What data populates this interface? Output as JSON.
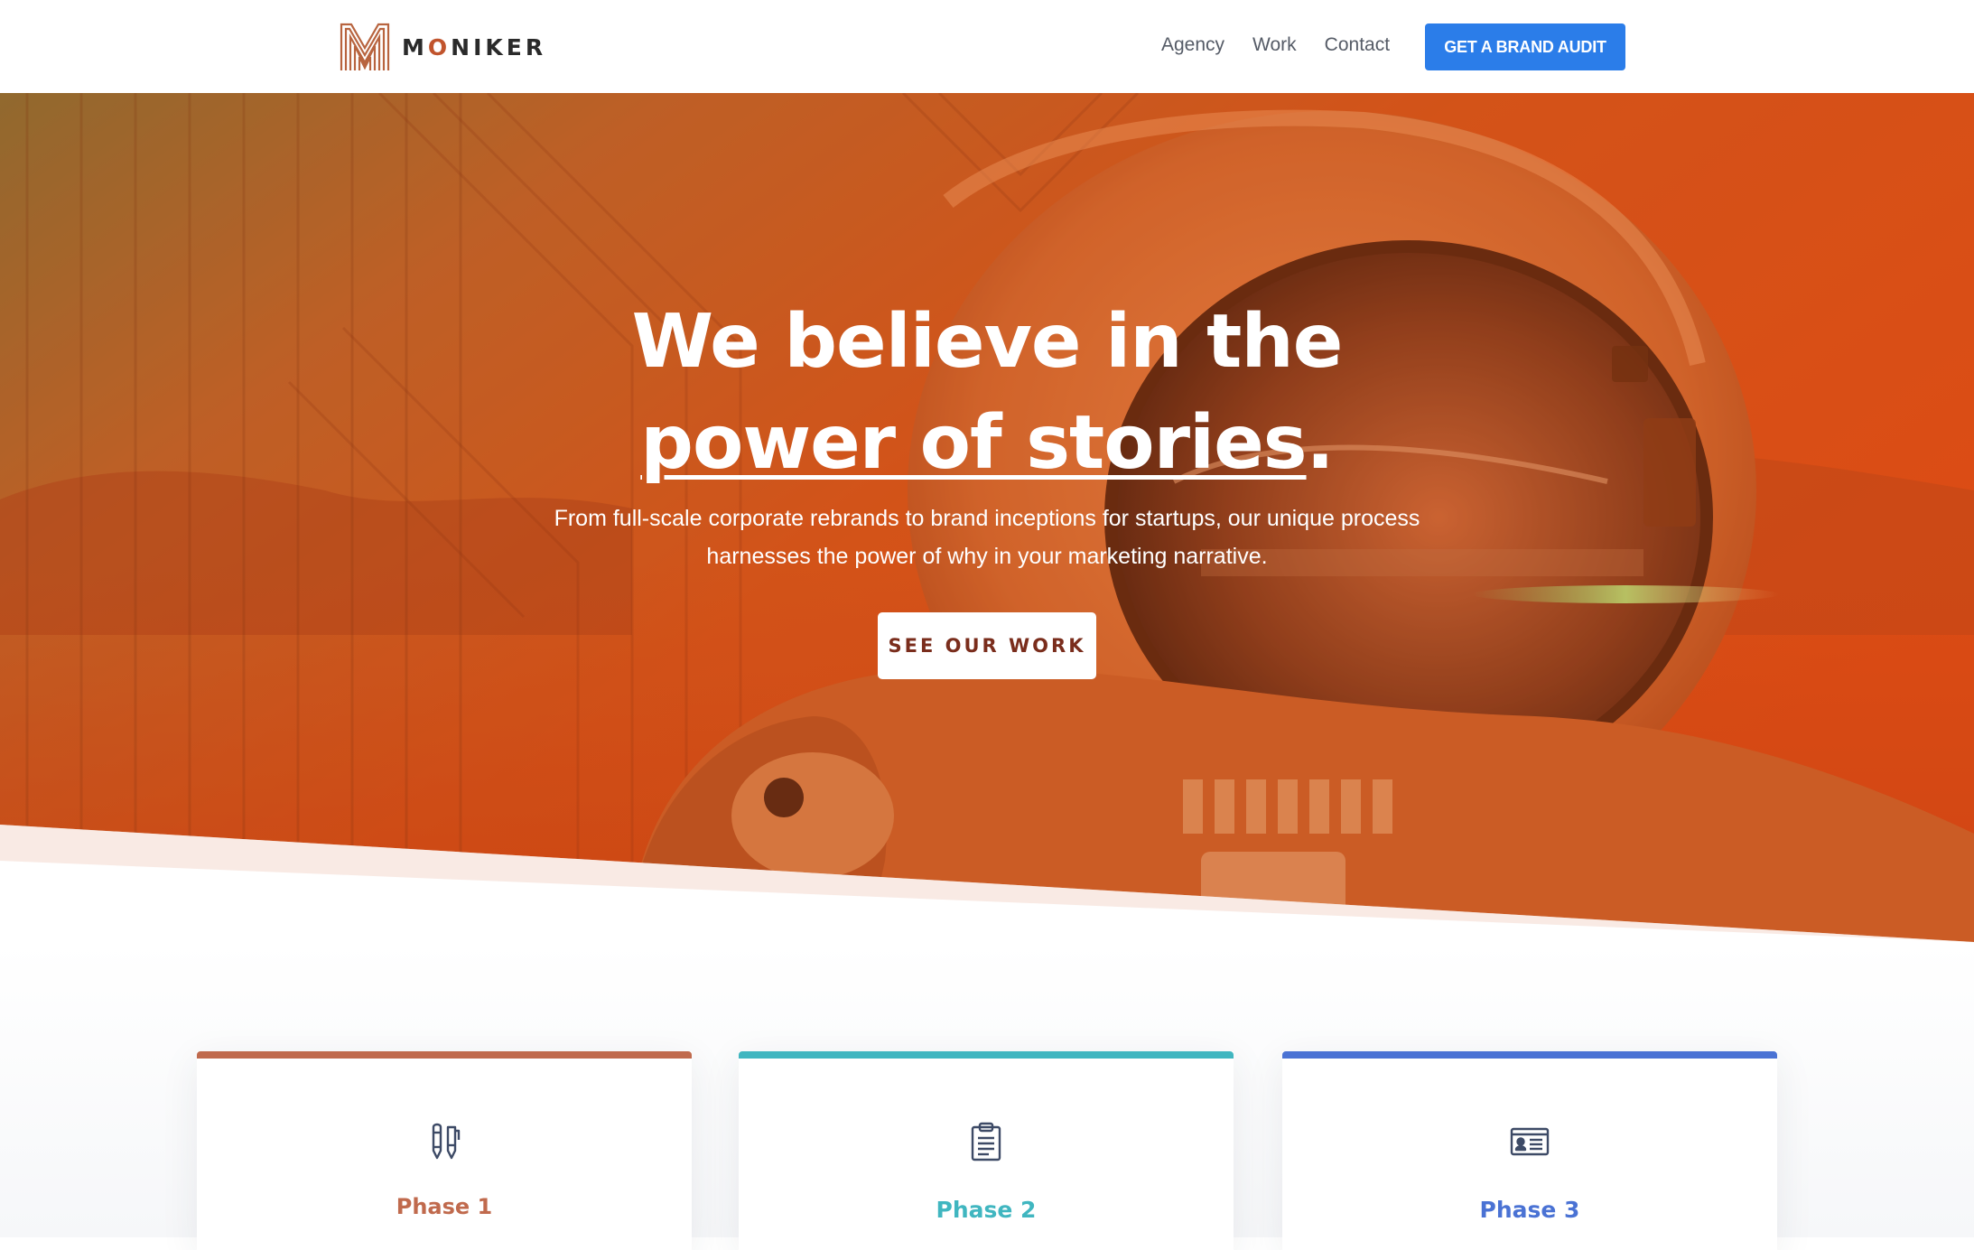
{
  "brand": {
    "name_pre": "M",
    "name_o": "O",
    "name_post": "NIKER"
  },
  "nav": {
    "items": [
      {
        "label": "Agency"
      },
      {
        "label": "Work"
      },
      {
        "label": "Contact"
      }
    ],
    "cta_label": "GET A BRAND AUDIT"
  },
  "hero": {
    "title_line1": "We believe in the",
    "title_underlined": "power of stories",
    "title_end": ".",
    "subtitle": "From full-scale corporate rebrands to brand inceptions for startups, our unique process harnesses the power of why in your marketing narrative.",
    "button_label": "SEE OUR WORK"
  },
  "phases": [
    {
      "title": "Phase 1",
      "icon": "pen-pencil-icon",
      "color": "#c06a4d"
    },
    {
      "title": "Phase 2",
      "icon": "clipboard-icon",
      "color": "#40b6c0"
    },
    {
      "title": "Phase 3",
      "icon": "id-card-icon",
      "color": "#4a72d4"
    }
  ],
  "colors": {
    "accent_blue": "#2b7de9",
    "hero_orange": "#d9541c",
    "brand_o": "#c1542d"
  }
}
